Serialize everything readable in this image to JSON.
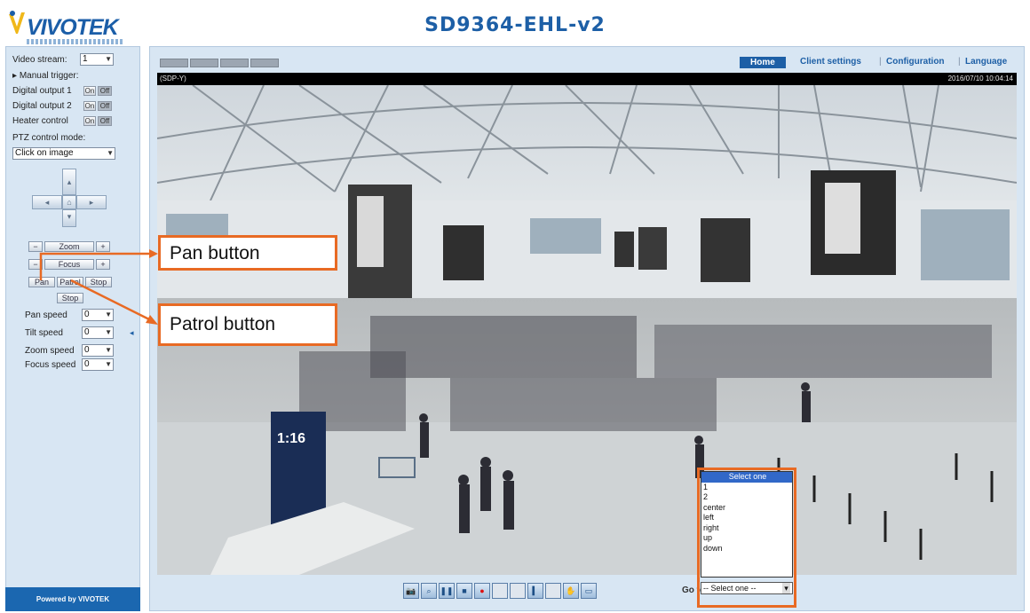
{
  "header": {
    "logo_text": "VIVOTEK",
    "title": "SD9364-EHL-v2"
  },
  "left_panel": {
    "video_stream_label": "Video stream:",
    "video_stream_value": "1",
    "manual_trigger_label": "Manual trigger:",
    "digital_output_1_label": "Digital output 1",
    "digital_output_2_label": "Digital output 2",
    "heater_control_label": "Heater control",
    "on_label": "On",
    "off_label": "Off",
    "ptz_mode_label": "PTZ control mode:",
    "ptz_mode_value": "Click on image",
    "zoom_label": "Zoom",
    "focus_label": "Focus",
    "pan_label": "Pan",
    "patrol_label": "Patrol",
    "stop_label": "Stop",
    "pan_speed_label": "Pan speed",
    "tilt_speed_label": "Tilt speed",
    "zoom_speed_label": "Zoom speed",
    "focus_speed_label": "Focus speed",
    "pan_speed_value": "0",
    "tilt_speed_value": "0",
    "zoom_speed_value": "0",
    "focus_speed_value": "0",
    "powered_by": "Powered by VIVOTEK"
  },
  "nav": {
    "home": "Home",
    "client_settings": "Client settings",
    "configuration": "Configuration",
    "language": "Language"
  },
  "video": {
    "channel_name": "(SDP-Y)",
    "timestamp": "2016/07/10 10:04:14",
    "sign_text": "1:16"
  },
  "controls": {
    "goto_label": "Go to"
  },
  "callouts": {
    "pan_button": "Pan button",
    "patrol_button": "Patrol button"
  },
  "preset_dropdown": {
    "options": [
      "Select one",
      "1",
      "2",
      "center",
      "left",
      "right",
      "up",
      "down"
    ],
    "selected": "-- Select one --"
  },
  "colors": {
    "accent": "#1d5fa6",
    "callout_border": "#e86a24",
    "panel_bg": "#d8e6f3"
  }
}
